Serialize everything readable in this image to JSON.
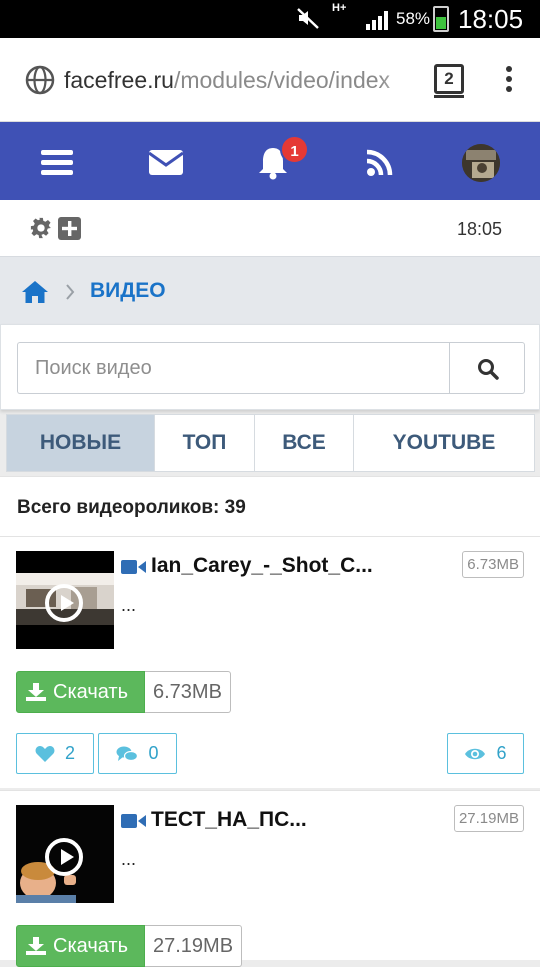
{
  "statusbar": {
    "network": "H+",
    "battery_pct": "58%",
    "time": "18:05",
    "battery_level": 0.58
  },
  "browser": {
    "url_domain": "facefree.ru",
    "url_path": "/modules/video/index",
    "tabs_count": "2"
  },
  "nav": {
    "notification_count": "1"
  },
  "tools": {
    "time": "18:05"
  },
  "breadcrumb": {
    "current": "ВИДЕО"
  },
  "search": {
    "placeholder": "Поиск видео",
    "value": ""
  },
  "tabs": [
    {
      "label": "НОВЫЕ",
      "active": true
    },
    {
      "label": "ТОП",
      "active": false
    },
    {
      "label": "ВСЕ",
      "active": false
    },
    {
      "label": "YOUTUBE",
      "active": false
    }
  ],
  "total": {
    "label": "Всего видеороликов: 39"
  },
  "videos": [
    {
      "title": "Ian_Carey_-_Shot_C...",
      "size": "6.73MB",
      "description": "...",
      "download_label": "Скачать",
      "download_size": "6.73MB",
      "likes": "2",
      "comments": "0",
      "views": "6"
    },
    {
      "title": "ТЕСТ_НА_ПС...",
      "size": "27.19MB",
      "description": "...",
      "download_label": "Скачать",
      "download_size": "27.19MB"
    }
  ],
  "colors": {
    "nav_bg": "#3f51b5",
    "accent_link": "#1a73c8",
    "download_green": "#5cb85c",
    "info_blue": "#5bc0de",
    "badge_red": "#e53935"
  }
}
